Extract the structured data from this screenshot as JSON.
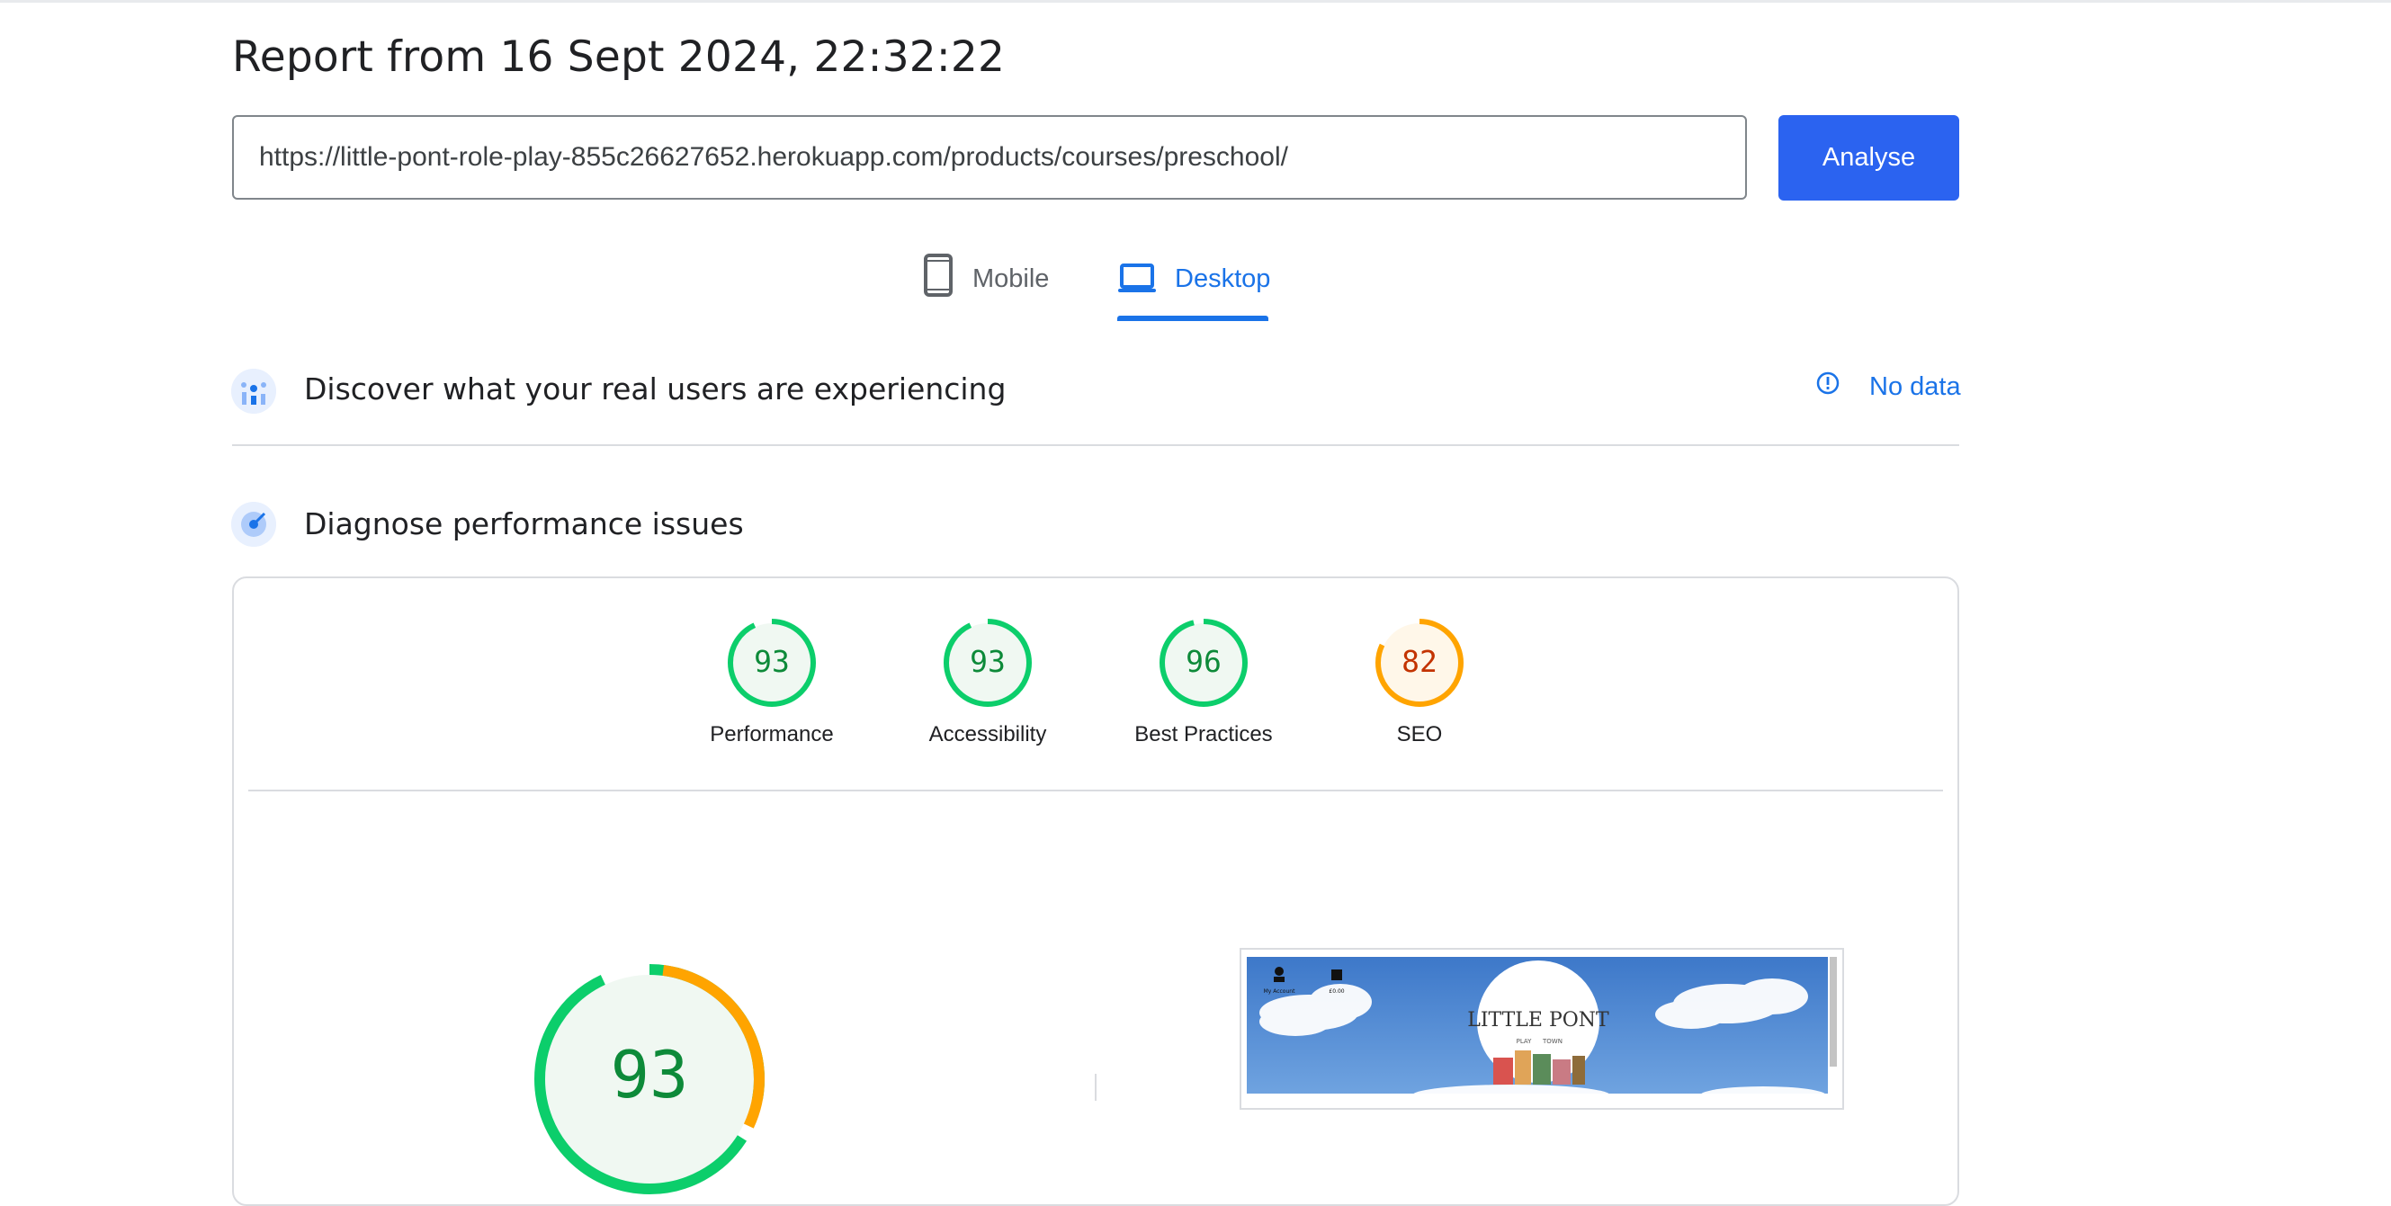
{
  "report": {
    "title": "Report from 16 Sept 2024, 22:32:22",
    "url_value": "https://little-pont-role-play-855c26627652.herokuapp.com/products/courses/preschool/",
    "analyse_label": "Analyse"
  },
  "device_tabs": [
    {
      "label": "Mobile",
      "icon": "phone-icon",
      "active": false
    },
    {
      "label": "Desktop",
      "icon": "laptop-icon",
      "active": true
    }
  ],
  "field_data": {
    "title": "Discover what your real users are experiencing",
    "status": "No data",
    "icon": "people-chart-icon"
  },
  "lab_data": {
    "title": "Diagnose performance issues",
    "icon": "radar-icon",
    "scores": [
      {
        "label": "Performance",
        "value": 93,
        "fraction": 0.93,
        "color": "#0cce6b",
        "text_color": "#0d8a39"
      },
      {
        "label": "Accessibility",
        "value": 93,
        "fraction": 0.93,
        "color": "#0cce6b",
        "text_color": "#0d8a39"
      },
      {
        "label": "Best Practices",
        "value": 96,
        "fraction": 0.96,
        "color": "#0cce6b",
        "text_color": "#0d8a39"
      },
      {
        "label": "SEO",
        "value": 82,
        "fraction": 0.82,
        "color": "#ffa400",
        "text_color": "#c33300"
      }
    ],
    "main_score": {
      "value": 93,
      "fraction": 0.93
    }
  },
  "preview": {
    "site_name": "LITTLE PONT",
    "tagline_left": "PLAY",
    "tagline_right": "TOWN",
    "nav_account": "My Account",
    "nav_bag": "£0.00"
  },
  "colors": {
    "accent": "#1a73e8",
    "button": "#2b63f0",
    "pass": "#0cce6b",
    "average": "#ffa400"
  }
}
